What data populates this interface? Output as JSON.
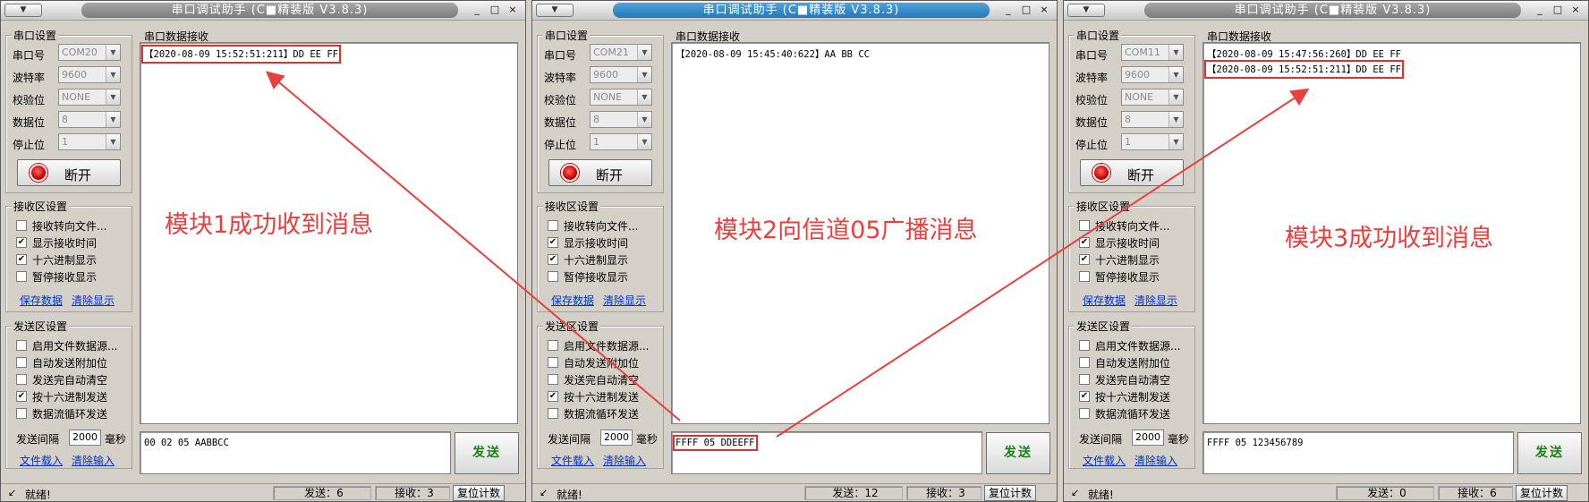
{
  "colors": {
    "annotation": "#e8403e",
    "link": "#0033cc",
    "send_text": "#1a7f1a",
    "titlebar_active": "#2a82c4"
  },
  "windows": [
    {
      "title": "串口调试助手 (C■精装版 V3.8.3)",
      "sysmenu": "▼",
      "ctrl": {
        "min": "_",
        "max": "□",
        "close": "×"
      },
      "serial_settings": {
        "group_title": "串口设置",
        "port_label": "串口号",
        "port_value": "COM20",
        "baud_label": "波特率",
        "baud_value": "9600",
        "parity_label": "校验位",
        "parity_value": "NONE",
        "databits_label": "数据位",
        "databits_value": "8",
        "stopbits_label": "停止位",
        "stopbits_value": "1",
        "open_button": "断开"
      },
      "recv_settings": {
        "group_title": "接收区设置",
        "options": [
          {
            "label": "接收转向文件...",
            "checked": ""
          },
          {
            "label": "显示接收时间",
            "checked": "✔"
          },
          {
            "label": "十六进制显示",
            "checked": "✔"
          },
          {
            "label": "暂停接收显示",
            "checked": ""
          }
        ],
        "save_link": "保存数据",
        "clear_link": "清除显示"
      },
      "send_settings": {
        "group_title": "发送区设置",
        "options": [
          {
            "label": "启用文件数据源...",
            "checked": ""
          },
          {
            "label": "自动发送附加位",
            "checked": ""
          },
          {
            "label": "发送完自动清空",
            "checked": ""
          },
          {
            "label": "按十六进制发送",
            "checked": "✔"
          },
          {
            "label": "数据流循环发送",
            "checked": ""
          }
        ],
        "interval_label": "发送间隔",
        "interval_value": "2000",
        "interval_unit": "毫秒",
        "load_link": "文件载入",
        "clear_input_link": "清除输入"
      },
      "recv_panel_title": "串口数据接收",
      "recv_lines": [
        "【2020-08-09 15:52:51:211】DD EE FF"
      ],
      "send_text": "00 02 05 AABBCC",
      "send_button": "发送",
      "status": {
        "ready": "就绪!",
        "sent": "发送：6",
        "received": "接收：3",
        "reset": "复位计数"
      }
    },
    {
      "title": "串口调试助手 (C■精装版 V3.8.3)",
      "sysmenu": "▼",
      "ctrl": {
        "min": "_",
        "max": "□",
        "close": "×"
      },
      "serial_settings": {
        "group_title": "串口设置",
        "port_label": "串口号",
        "port_value": "COM21",
        "baud_label": "波特率",
        "baud_value": "9600",
        "parity_label": "校验位",
        "parity_value": "NONE",
        "databits_label": "数据位",
        "databits_value": "8",
        "stopbits_label": "停止位",
        "stopbits_value": "1",
        "open_button": "断开"
      },
      "recv_settings": {
        "group_title": "接收区设置",
        "options": [
          {
            "label": "接收转向文件...",
            "checked": ""
          },
          {
            "label": "显示接收时间",
            "checked": "✔"
          },
          {
            "label": "十六进制显示",
            "checked": "✔"
          },
          {
            "label": "暂停接收显示",
            "checked": ""
          }
        ],
        "save_link": "保存数据",
        "clear_link": "清除显示"
      },
      "send_settings": {
        "group_title": "发送区设置",
        "options": [
          {
            "label": "启用文件数据源...",
            "checked": ""
          },
          {
            "label": "自动发送附加位",
            "checked": ""
          },
          {
            "label": "发送完自动清空",
            "checked": ""
          },
          {
            "label": "按十六进制发送",
            "checked": "✔"
          },
          {
            "label": "数据流循环发送",
            "checked": ""
          }
        ],
        "interval_label": "发送间隔",
        "interval_value": "2000",
        "interval_unit": "毫秒",
        "load_link": "文件载入",
        "clear_input_link": "清除输入"
      },
      "recv_panel_title": "串口数据接收",
      "recv_lines": [
        "【2020-08-09 15:45:40:622】AA BB CC"
      ],
      "send_text": "FFFF 05 DDEEFF",
      "send_button": "发送",
      "status": {
        "ready": "就绪!",
        "sent": "发送：12",
        "received": "接收：3",
        "reset": "复位计数"
      }
    },
    {
      "title": "串口调试助手 (C■精装版 V3.8.3)",
      "sysmenu": "▼",
      "ctrl": {
        "min": "_",
        "max": "□",
        "close": "×"
      },
      "serial_settings": {
        "group_title": "串口设置",
        "port_label": "串口号",
        "port_value": "COM11",
        "baud_label": "波特率",
        "baud_value": "9600",
        "parity_label": "校验位",
        "parity_value": "NONE",
        "databits_label": "数据位",
        "databits_value": "8",
        "stopbits_label": "停止位",
        "stopbits_value": "1",
        "open_button": "断开"
      },
      "recv_settings": {
        "group_title": "接收区设置",
        "options": [
          {
            "label": "接收转向文件...",
            "checked": ""
          },
          {
            "label": "显示接收时间",
            "checked": "✔"
          },
          {
            "label": "十六进制显示",
            "checked": "✔"
          },
          {
            "label": "暂停接收显示",
            "checked": ""
          }
        ],
        "save_link": "保存数据",
        "clear_link": "清除显示"
      },
      "send_settings": {
        "group_title": "发送区设置",
        "options": [
          {
            "label": "启用文件数据源...",
            "checked": ""
          },
          {
            "label": "自动发送附加位",
            "checked": ""
          },
          {
            "label": "发送完自动清空",
            "checked": ""
          },
          {
            "label": "按十六进制发送",
            "checked": "✔"
          },
          {
            "label": "数据流循环发送",
            "checked": ""
          }
        ],
        "interval_label": "发送间隔",
        "interval_value": "2000",
        "interval_unit": "毫秒",
        "load_link": "文件载入",
        "clear_input_link": "清除输入"
      },
      "recv_panel_title": "串口数据接收",
      "recv_lines": [
        "【2020-08-09 15:47:56:260】DD EE FF",
        "【2020-08-09 15:52:51:211】DD EE FF"
      ],
      "send_text": "FFFF 05 123456789",
      "send_button": "发送",
      "status": {
        "ready": "就绪!",
        "sent": "发送：0",
        "received": "接收：6",
        "reset": "复位计数"
      }
    }
  ],
  "annotations": {
    "module1": "模块1成功收到消息",
    "module2": "模块2向信道05广播消息",
    "module3": "模块3成功收到消息"
  }
}
